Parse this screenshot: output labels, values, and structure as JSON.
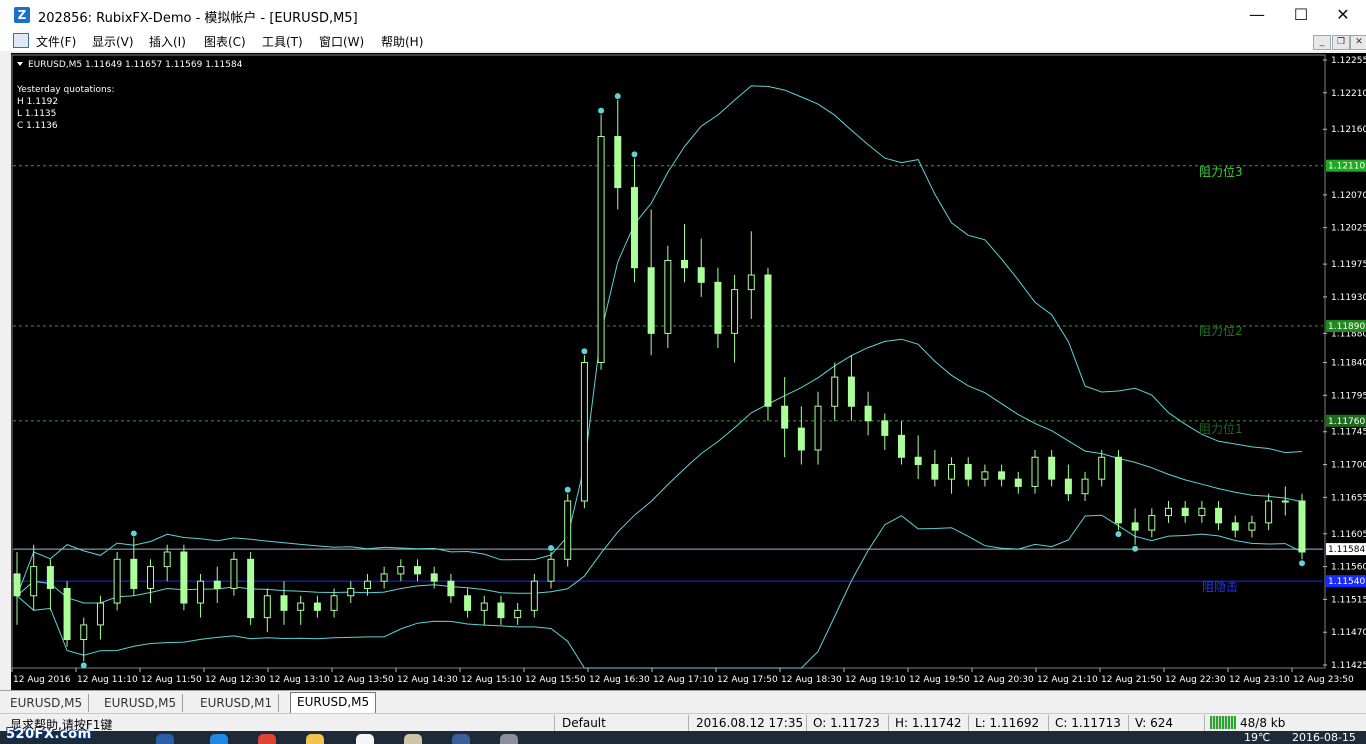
{
  "window": {
    "title": "202856: RubixFX-Demo - 模拟帐户 - [EURUSD,M5]",
    "app_icon_glyph": "Z",
    "minimize_glyph": "—",
    "maximize_glyph": "☐",
    "close_glyph": "✕"
  },
  "menu": {
    "items": [
      "文件(F)",
      "显示(V)",
      "插入(I)",
      "图表(C)",
      "工具(T)",
      "窗口(W)",
      "帮助(H)"
    ],
    "mdi_minimize": "_",
    "mdi_restore": "❐",
    "mdi_close": "✕"
  },
  "chart": {
    "header": "EURUSD,M5  1.11649 1.11657 1.11569 1.11584",
    "yesterday_title": "Yesterday quotations:",
    "yesterday_h": "H 1.1192",
    "yesterday_l": "L 1.1135",
    "yesterday_c": "C 1.1136",
    "level_labels": [
      "阻力位3",
      "阻力位2",
      "阻力位1",
      "阻隐击"
    ],
    "price_badges": [
      "1.12110",
      "1.11890",
      "1.11760",
      "1.11584",
      "1.11540"
    ],
    "price_ticks": [
      "1.12255",
      "1.12210",
      "1.12160",
      "1.12070",
      "1.12025",
      "1.11975",
      "1.11930",
      "1.11880",
      "1.11840",
      "1.11795",
      "1.11745",
      "1.11700",
      "1.11655",
      "1.11605",
      "1.11560",
      "1.11515",
      "1.11470",
      "1.11425"
    ],
    "time_ticks": [
      "12 Aug 2016",
      "12 Aug 11:10",
      "12 Aug 11:50",
      "12 Aug 12:30",
      "12 Aug 13:10",
      "12 Aug 13:50",
      "12 Aug 14:30",
      "12 Aug 15:10",
      "12 Aug 15:50",
      "12 Aug 16:30",
      "12 Aug 17:10",
      "12 Aug 17:50",
      "12 Aug 18:30",
      "12 Aug 19:10",
      "12 Aug 19:50",
      "12 Aug 20:30",
      "12 Aug 21:10",
      "12 Aug 21:50",
      "12 Aug 22:30",
      "12 Aug 23:10",
      "12 Aug 23:50"
    ],
    "colors": {
      "background": "#000000",
      "candle": "#aaff99",
      "band": "#5fd3d8",
      "level_line": "#2f9f2f",
      "bid_line": "#9fb6c9",
      "support_line": "#1a2bff",
      "grid_label": "#ffffff"
    }
  },
  "chart_data": {
    "type": "candlestick",
    "symbol": "EURUSD",
    "timeframe": "M5",
    "ylim": [
      1.11425,
      1.12255
    ],
    "levels": {
      "resistance3": 1.1211,
      "resistance2": 1.1189,
      "resistance1": 1.1176,
      "bid": 1.11584,
      "support": 1.1154
    },
    "ohlc": [
      [
        1.1155,
        1.1158,
        1.1148,
        1.1152
      ],
      [
        1.1152,
        1.1159,
        1.115,
        1.1156
      ],
      [
        1.1156,
        1.1157,
        1.115,
        1.1153
      ],
      [
        1.1153,
        1.1154,
        1.1145,
        1.1146
      ],
      [
        1.1146,
        1.1149,
        1.1143,
        1.1148
      ],
      [
        1.1148,
        1.1152,
        1.1146,
        1.1151
      ],
      [
        1.1151,
        1.1158,
        1.115,
        1.1157
      ],
      [
        1.1157,
        1.116,
        1.1152,
        1.1153
      ],
      [
        1.1153,
        1.1157,
        1.1151,
        1.1156
      ],
      [
        1.1156,
        1.1159,
        1.1154,
        1.1158
      ],
      [
        1.1158,
        1.1159,
        1.115,
        1.1151
      ],
      [
        1.1151,
        1.1155,
        1.1149,
        1.1154
      ],
      [
        1.1154,
        1.1156,
        1.1151,
        1.1153
      ],
      [
        1.1153,
        1.1158,
        1.1152,
        1.1157
      ],
      [
        1.1157,
        1.1158,
        1.1148,
        1.1149
      ],
      [
        1.1149,
        1.1153,
        1.1147,
        1.1152
      ],
      [
        1.1152,
        1.1154,
        1.1148,
        1.115
      ],
      [
        1.115,
        1.1152,
        1.1148,
        1.1151
      ],
      [
        1.1151,
        1.1152,
        1.1149,
        1.115
      ],
      [
        1.115,
        1.1153,
        1.1149,
        1.1152
      ],
      [
        1.1152,
        1.1154,
        1.1151,
        1.1153
      ],
      [
        1.1153,
        1.1155,
        1.1152,
        1.1154
      ],
      [
        1.1154,
        1.1156,
        1.1153,
        1.1155
      ],
      [
        1.1155,
        1.1157,
        1.1154,
        1.1156
      ],
      [
        1.1156,
        1.1157,
        1.1154,
        1.1155
      ],
      [
        1.1155,
        1.1156,
        1.1153,
        1.1154
      ],
      [
        1.1154,
        1.1155,
        1.1151,
        1.1152
      ],
      [
        1.1152,
        1.1153,
        1.1149,
        1.115
      ],
      [
        1.115,
        1.1152,
        1.1148,
        1.1151
      ],
      [
        1.1151,
        1.1152,
        1.1148,
        1.1149
      ],
      [
        1.1149,
        1.1151,
        1.1148,
        1.115
      ],
      [
        1.115,
        1.1155,
        1.1149,
        1.1154
      ],
      [
        1.1154,
        1.1158,
        1.1153,
        1.1157
      ],
      [
        1.1157,
        1.1166,
        1.1156,
        1.1165
      ],
      [
        1.1165,
        1.1185,
        1.1164,
        1.1184
      ],
      [
        1.1184,
        1.1218,
        1.1183,
        1.1215
      ],
      [
        1.1215,
        1.122,
        1.1205,
        1.1208
      ],
      [
        1.1208,
        1.1212,
        1.1195,
        1.1197
      ],
      [
        1.1197,
        1.1205,
        1.1185,
        1.1188
      ],
      [
        1.1188,
        1.12,
        1.1186,
        1.1198
      ],
      [
        1.1198,
        1.1203,
        1.1195,
        1.1197
      ],
      [
        1.1197,
        1.1201,
        1.1193,
        1.1195
      ],
      [
        1.1195,
        1.1197,
        1.1186,
        1.1188
      ],
      [
        1.1188,
        1.1196,
        1.1184,
        1.1194
      ],
      [
        1.1194,
        1.1202,
        1.119,
        1.1196
      ],
      [
        1.1196,
        1.1197,
        1.1176,
        1.1178
      ],
      [
        1.1178,
        1.1182,
        1.1171,
        1.1175
      ],
      [
        1.1175,
        1.1178,
        1.117,
        1.1172
      ],
      [
        1.1172,
        1.118,
        1.117,
        1.1178
      ],
      [
        1.1178,
        1.1184,
        1.1176,
        1.1182
      ],
      [
        1.1182,
        1.1185,
        1.1176,
        1.1178
      ],
      [
        1.1178,
        1.118,
        1.1174,
        1.1176
      ],
      [
        1.1176,
        1.1177,
        1.1172,
        1.1174
      ],
      [
        1.1174,
        1.1176,
        1.117,
        1.1171
      ],
      [
        1.1171,
        1.1174,
        1.1168,
        1.117
      ],
      [
        1.117,
        1.1172,
        1.1167,
        1.1168
      ],
      [
        1.1168,
        1.1171,
        1.1166,
        1.117
      ],
      [
        1.117,
        1.1171,
        1.1167,
        1.1168
      ],
      [
        1.1168,
        1.117,
        1.1167,
        1.1169
      ],
      [
        1.1169,
        1.117,
        1.1167,
        1.1168
      ],
      [
        1.1168,
        1.1169,
        1.1166,
        1.1167
      ],
      [
        1.1167,
        1.1172,
        1.1166,
        1.1171
      ],
      [
        1.1171,
        1.1172,
        1.1167,
        1.1168
      ],
      [
        1.1168,
        1.117,
        1.1165,
        1.1166
      ],
      [
        1.1166,
        1.1169,
        1.1165,
        1.1168
      ],
      [
        1.1168,
        1.1172,
        1.1167,
        1.1171
      ],
      [
        1.1171,
        1.1172,
        1.1161,
        1.1162
      ],
      [
        1.1162,
        1.1164,
        1.1159,
        1.1161
      ],
      [
        1.1161,
        1.1164,
        1.116,
        1.1163
      ],
      [
        1.1163,
        1.1165,
        1.1162,
        1.1164
      ],
      [
        1.1164,
        1.1165,
        1.1162,
        1.1163
      ],
      [
        1.1163,
        1.1165,
        1.1162,
        1.1164
      ],
      [
        1.1164,
        1.1165,
        1.1161,
        1.1162
      ],
      [
        1.1162,
        1.1163,
        1.116,
        1.1161
      ],
      [
        1.1161,
        1.1163,
        1.116,
        1.1162
      ],
      [
        1.1162,
        1.1166,
        1.1161,
        1.1165
      ],
      [
        1.1165,
        1.1167,
        1.1163,
        1.1165
      ],
      [
        1.1165,
        1.1166,
        1.1157,
        1.1158
      ]
    ]
  },
  "tabs": [
    "EURUSD,M5",
    "EURUSD,M5",
    "EURUSD,M1",
    "EURUSD,M5"
  ],
  "status": {
    "help": "显求帮助,请按F1键",
    "profile": "Default",
    "datetime": "2016.08.12 17:35",
    "open": "O: 1.11723",
    "high": "H: 1.11742",
    "low": "L: 1.11692",
    "close": "C: 1.11713",
    "volume": "V: 624",
    "traffic": "48/8 kb"
  },
  "taskbar": {
    "watermark": "520FX.com",
    "weather": "19℃",
    "date": "2016-08-15"
  }
}
